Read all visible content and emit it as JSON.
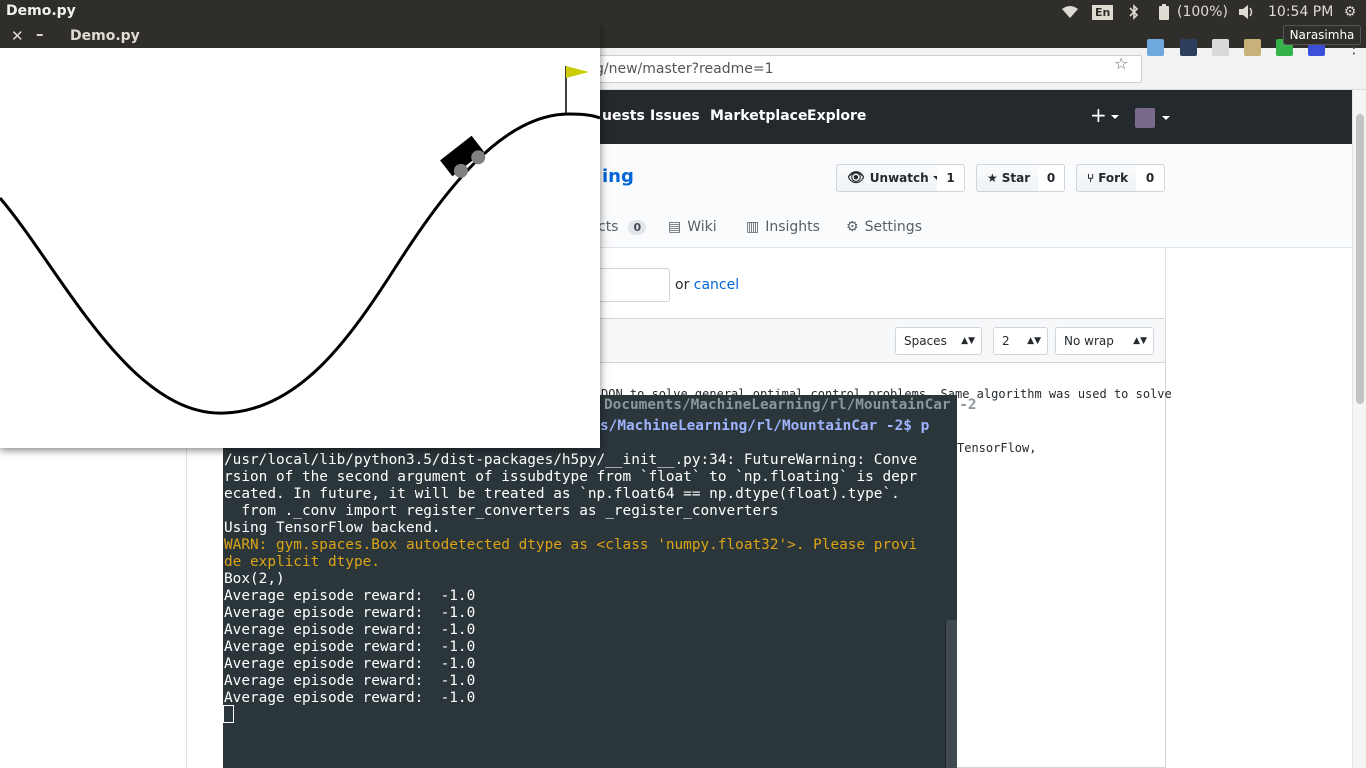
{
  "topbar": {
    "app_title": "Demo.py",
    "keyboard": "En",
    "battery": "(100%)",
    "time": "10:54 PM",
    "user_tooltip": "Narasimha"
  },
  "browser": {
    "url": "g/new/master?readme=1"
  },
  "github": {
    "nav": [
      "uests",
      "Issues",
      "Marketplace",
      "Explore"
    ],
    "repo_title": "ing",
    "unwatch_label": "Unwatch",
    "unwatch_count": "1",
    "star_label": "Star",
    "star_count": "0",
    "fork_label": "Fork",
    "fork_count": "0",
    "tabs": {
      "projects_label": "cts",
      "projects_count": "0",
      "wiki": "Wiki",
      "insights": "Insights",
      "settings": "Settings"
    },
    "or_text": "or",
    "cancel": "cancel",
    "indent_mode": "Spaces",
    "indent_size": "2",
    "wrap_mode": "No wrap",
    "code_line_1": "DQN to solve general optimal control problems. Same algorithm was used to solve",
    "code_line_2": "TensorFlow,"
  },
  "terminal": {
    "title": "Documents/MachineLearning/rl/MountainCar -2",
    "prompt": "s/MachineLearning/rl/MountainCar -2$ p",
    "lines": [
      "/usr/local/lib/python3.5/dist-packages/h5py/__init__.py:34: FutureWarning: Conve",
      "rsion of the second argument of issubdtype from `float` to `np.floating` is depr",
      "ecated. In future, it will be treated as `np.float64 == np.dtype(float).type`.",
      "  from ._conv import register_converters as _register_converters",
      "Using TensorFlow backend."
    ],
    "warn_lines": [
      "WARN: gym.spaces.Box autodetected dtype as <class 'numpy.float32'>. Please provi",
      "de explicit dtype."
    ],
    "box_line": "Box(2,)",
    "reward_lines": [
      "Average episode reward:  -1.0",
      "Average episode reward:  -1.0",
      "Average episode reward:  -1.0",
      "Average episode reward:  -1.0",
      "Average episode reward:  -1.0",
      "Average episode reward:  -1.0",
      "Average episode reward:  -1.0"
    ]
  },
  "gym_window": {
    "title": "Demo.py",
    "close_glyph": "✕",
    "minimize_glyph": "–",
    "flag_color": "#cccc00",
    "track_color": "#000000",
    "car_color": "#000000",
    "wheel_color": "#808080"
  }
}
